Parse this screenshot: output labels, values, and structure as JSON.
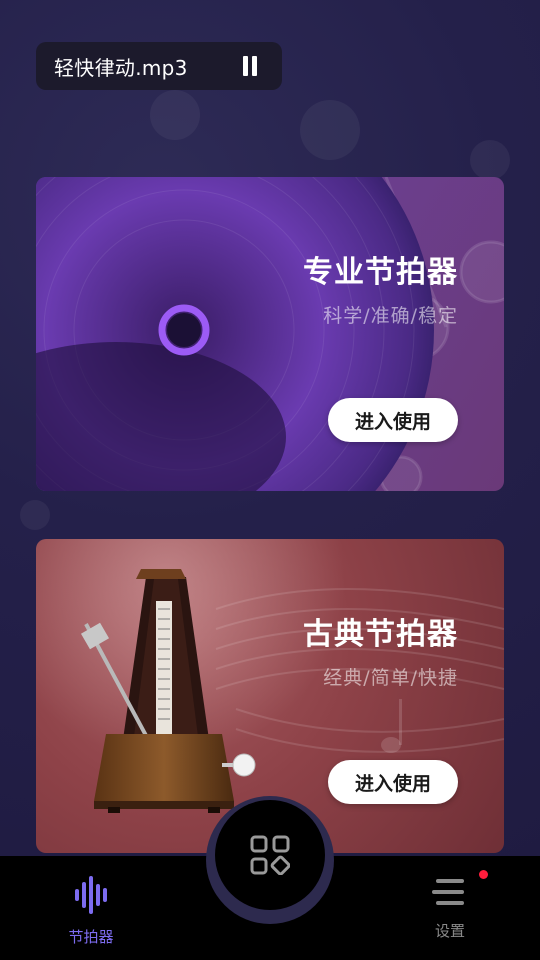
{
  "now_playing": {
    "track": "轻快律动.mp3",
    "control_icon": "pause-icon"
  },
  "cards": [
    {
      "title": "专业节拍器",
      "subtitle": "科学/准确/稳定",
      "button": "进入使用",
      "art": "vinyl-record-illustration",
      "accent": "#6b3f8f"
    },
    {
      "title": "古典节拍器",
      "subtitle": "经典/简单/快捷",
      "button": "进入使用",
      "art": "mechanical-metronome-illustration",
      "accent": "#8e4248"
    }
  ],
  "bottom_nav": {
    "items": [
      {
        "label": "节拍器",
        "icon": "waveform-icon",
        "active": true,
        "color": "#7d6cf0"
      },
      {
        "label": "设置",
        "icon": "menu-lines-icon",
        "active": false,
        "badge": true,
        "color": "#8a8a8a"
      }
    ],
    "center_icon": "grid-apps-icon"
  }
}
